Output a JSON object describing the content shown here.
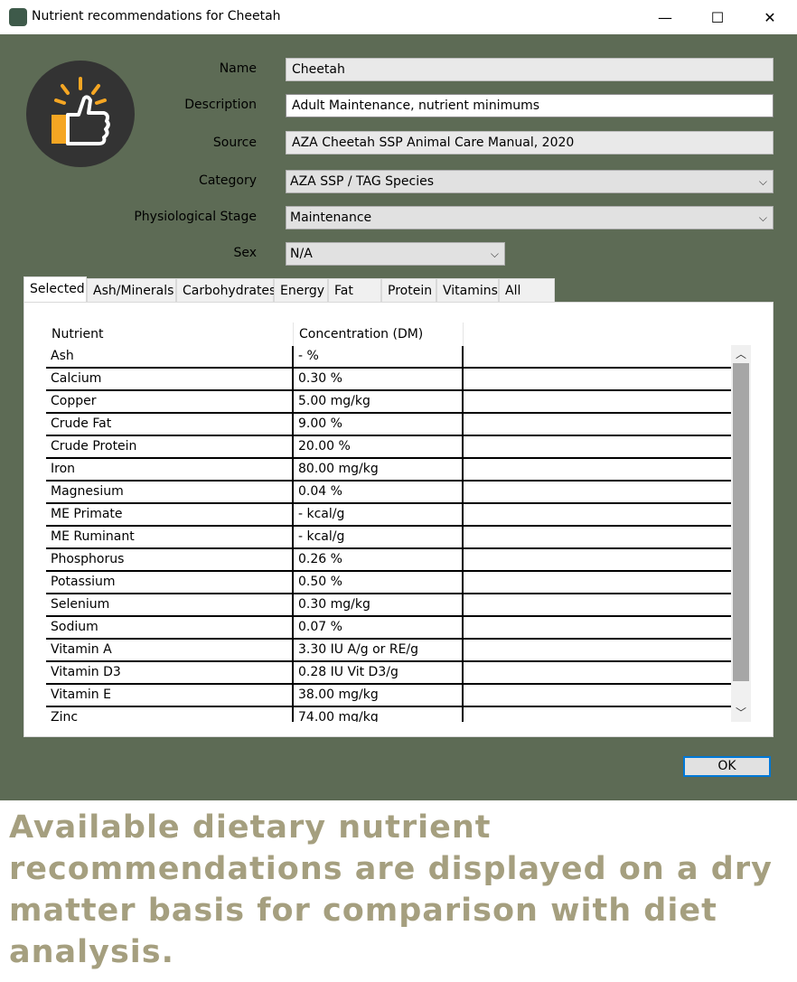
{
  "window": {
    "title": "Nutrient recommendations for Cheetah",
    "minimize": "—",
    "maximize": "☐",
    "close": "✕"
  },
  "form": {
    "name_label": "Name",
    "name_value": "Cheetah",
    "description_label": "Description",
    "description_value": "Adult Maintenance, nutrient minimums",
    "source_label": "Source",
    "source_value": "AZA Cheetah SSP Animal Care Manual, 2020",
    "category_label": "Category",
    "category_value": "AZA SSP / TAG Species",
    "stage_label": "Physiological Stage",
    "stage_value": "Maintenance",
    "sex_label": "Sex",
    "sex_value": "N/A"
  },
  "tabs": [
    "Selected",
    "Ash/Minerals",
    "Carbohydrates",
    "Energy",
    "Fat",
    "Protein",
    "Vitamins",
    "All"
  ],
  "table": {
    "headers": [
      "Nutrient",
      "Concentration (DM)"
    ],
    "rows": [
      [
        "Ash",
        "- %"
      ],
      [
        "Calcium",
        "0.30 %"
      ],
      [
        "Copper",
        "5.00 mg/kg"
      ],
      [
        "Crude Fat",
        "9.00 %"
      ],
      [
        "Crude Protein",
        "20.00 %"
      ],
      [
        "Iron",
        "80.00 mg/kg"
      ],
      [
        "Magnesium",
        "0.04 %"
      ],
      [
        "ME Primate",
        "- kcal/g"
      ],
      [
        "ME Ruminant",
        "- kcal/g"
      ],
      [
        "Phosphorus",
        "0.26 %"
      ],
      [
        "Potassium",
        "0.50 %"
      ],
      [
        "Selenium",
        "0.30 mg/kg"
      ],
      [
        "Sodium",
        "0.07 %"
      ],
      [
        "Vitamin A",
        "3.30 IU A/g or RE/g"
      ],
      [
        "Vitamin D3",
        "0.28 IU Vit D3/g"
      ],
      [
        "Vitamin E",
        "38.00 mg/kg"
      ],
      [
        "Zinc",
        "74.00 mg/kg"
      ]
    ]
  },
  "buttons": {
    "ok": "OK"
  },
  "caption": "Available dietary nutrient recommendations are displayed on a dry matter basis for comparison with diet analysis.",
  "colors": {
    "window_bg": "#5d6b55",
    "caption": "#a59f7f",
    "logo_accent": "#f5a623"
  }
}
